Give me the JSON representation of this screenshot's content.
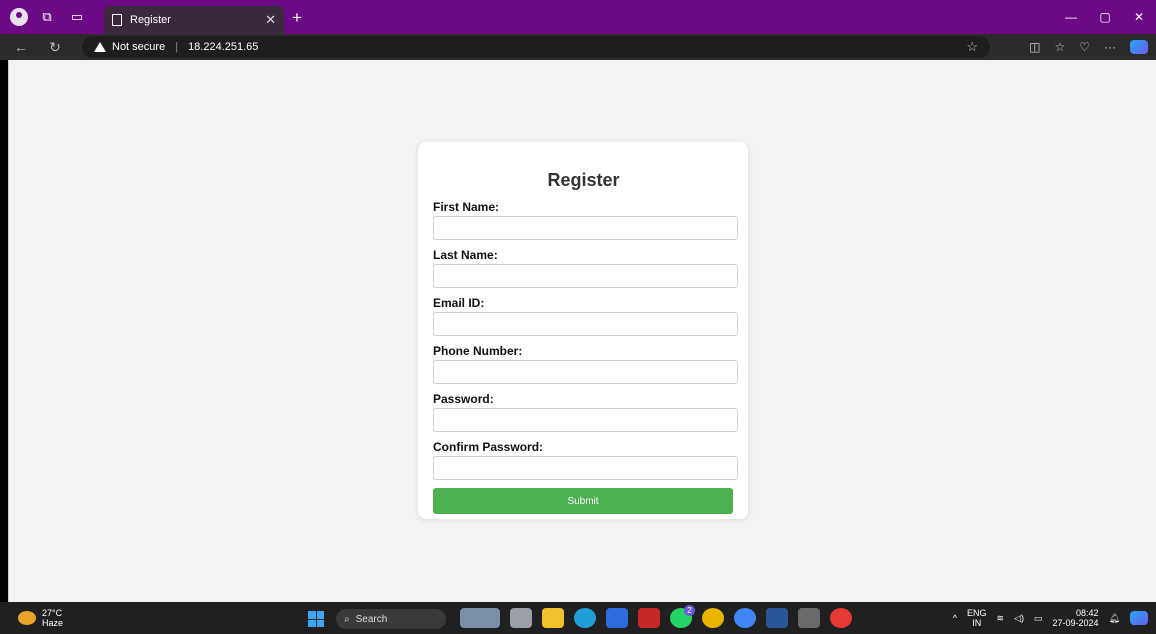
{
  "browser": {
    "tab_title": "Register",
    "security_label": "Not secure",
    "url": "18.224.251.65"
  },
  "form": {
    "title": "Register",
    "fields": [
      {
        "label": "First Name:"
      },
      {
        "label": "Last Name:"
      },
      {
        "label": "Email ID:"
      },
      {
        "label": "Phone Number:"
      },
      {
        "label": "Password:"
      },
      {
        "label": "Confirm Password:"
      }
    ],
    "submit_label": "Submit",
    "submit_color": "#4caf50"
  },
  "taskbar": {
    "weather_temp": "27°C",
    "weather_desc": "Haze",
    "search_label": "Search",
    "lang_top": "ENG",
    "lang_bottom": "IN",
    "time": "08:42",
    "date": "27-09-2024",
    "whatsapp_badge": "2"
  },
  "colors": {
    "titlebar": "#6c0a85",
    "page_bg": "#f3f3f3"
  }
}
